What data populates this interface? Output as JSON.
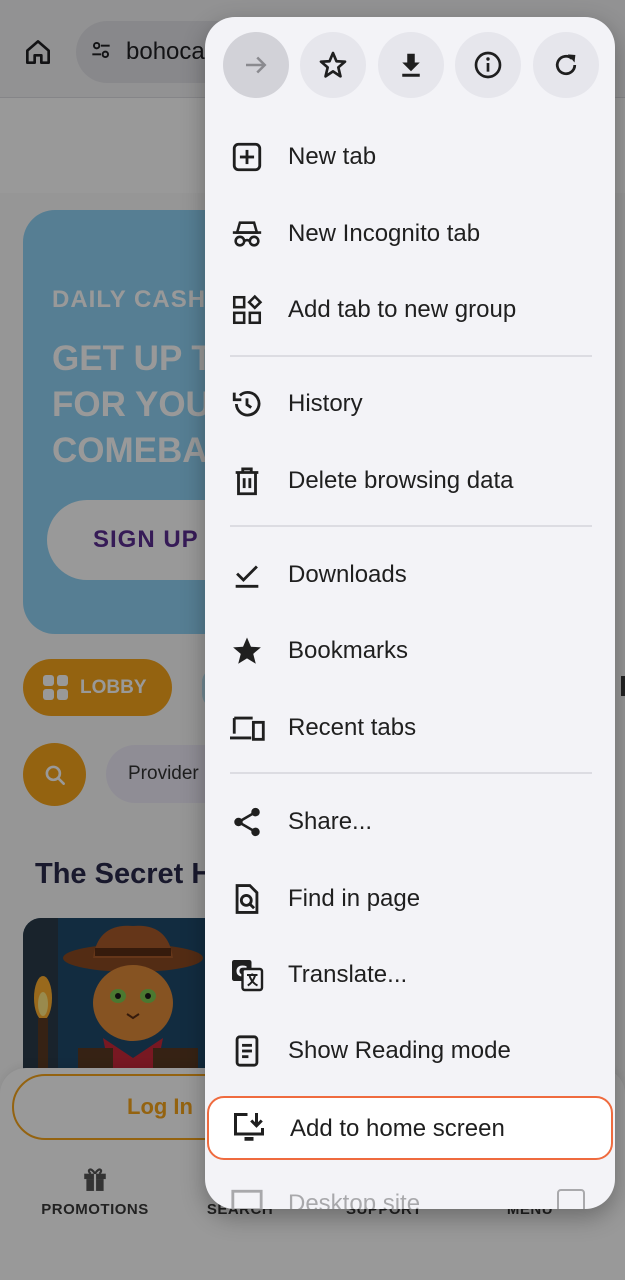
{
  "browser": {
    "url_text": "bohoca",
    "icons": {
      "home": "home-icon",
      "site_settings": "tune-icon"
    }
  },
  "page": {
    "hero": {
      "kicker": "DAILY CASH",
      "title": "GET UP T\nFOR YOU\nCOMEBA",
      "signup_label": "SIGN UP"
    },
    "lobby_label": "LOBBY",
    "provider_label": "Provider",
    "section_title": "The Secret H",
    "login_label": "Log In",
    "bottom_nav": [
      {
        "label": "PROMOTIONS",
        "icon": "gift-icon"
      },
      {
        "label": "SEARCH",
        "icon": "search-icon"
      },
      {
        "label": "SUPPORT",
        "icon": "chat-icon"
      },
      {
        "label": "MENU",
        "icon": "menu-icon"
      }
    ],
    "colors": {
      "accent_orange": "#f7a51c",
      "hero_blue": "#8fd3f5",
      "signup_purple": "#5b2d91"
    }
  },
  "menu": {
    "top_actions": [
      {
        "name": "forward",
        "icon": "arrow-forward-icon"
      },
      {
        "name": "bookmark",
        "icon": "star-outline-icon"
      },
      {
        "name": "download",
        "icon": "download-icon"
      },
      {
        "name": "page-info",
        "icon": "info-icon"
      },
      {
        "name": "reload",
        "icon": "refresh-icon"
      }
    ],
    "items": [
      {
        "label": "New tab",
        "icon": "plus-square-icon"
      },
      {
        "label": "New Incognito tab",
        "icon": "incognito-icon"
      },
      {
        "label": "Add tab to new group",
        "icon": "tab-group-icon"
      },
      {
        "label": "History",
        "icon": "history-icon"
      },
      {
        "label": "Delete browsing data",
        "icon": "trash-icon"
      },
      {
        "label": "Downloads",
        "icon": "download-check-icon"
      },
      {
        "label": "Bookmarks",
        "icon": "star-filled-icon"
      },
      {
        "label": "Recent tabs",
        "icon": "devices-icon"
      },
      {
        "label": "Share...",
        "icon": "share-icon"
      },
      {
        "label": "Find in page",
        "icon": "find-in-page-icon"
      },
      {
        "label": "Translate...",
        "icon": "translate-icon"
      },
      {
        "label": "Show Reading mode",
        "icon": "reading-mode-icon"
      },
      {
        "label": "Add to home screen",
        "icon": "add-to-home-icon"
      },
      {
        "label": "Desktop site",
        "icon": "desktop-icon"
      }
    ],
    "highlight_color": "#ef6b3f"
  }
}
